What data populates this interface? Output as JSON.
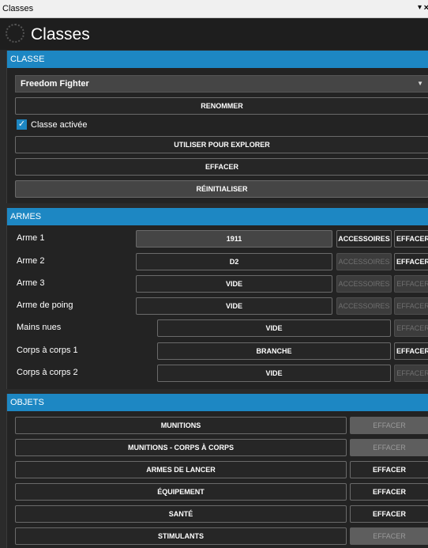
{
  "window": {
    "title": "Classes",
    "menu_icon": "▾",
    "close_icon": "×"
  },
  "header": {
    "title": "Classes",
    "logo_icon": "circle-dotted-icon"
  },
  "classe": {
    "section_label": "CLASSE",
    "selected": "Freedom Fighter",
    "dropdown_icon": "▼",
    "rename_label": "RENOMMER",
    "active_label": "Classe activée",
    "active_checked": true,
    "check_mark": "✓",
    "explore_label": "UTILISER POUR EXPLORER",
    "clear_label": "EFFACER",
    "reset_label": "RÉINITIALISER"
  },
  "armes": {
    "section_label": "ARMES",
    "rows": [
      {
        "label": "Arme 1",
        "value": "1911",
        "accessories": "ACCESSOIRES",
        "accessories_enabled": true,
        "clear": "EFFACER",
        "clear_enabled": true
      },
      {
        "label": "Arme 2",
        "value": "D2",
        "accessories": "ACCESSOIRES",
        "accessories_enabled": false,
        "clear": "EFFACER",
        "clear_enabled": true
      },
      {
        "label": "Arme 3",
        "value": "VIDE",
        "accessories": "ACCESSOIRES",
        "accessories_enabled": false,
        "clear": "EFFACER",
        "clear_enabled": false
      },
      {
        "label": "Arme de poing",
        "value": "VIDE",
        "accessories": "ACCESSOIRES",
        "accessories_enabled": false,
        "clear": "EFFACER",
        "clear_enabled": false
      },
      {
        "label": "Mains nues",
        "value": "VIDE",
        "clear": "EFFACER",
        "clear_enabled": false
      },
      {
        "label": "Corps à corps 1",
        "value": "BRANCHE",
        "clear": "EFFACER",
        "clear_enabled": true
      },
      {
        "label": "Corps à corps 2",
        "value": "VIDE",
        "clear": "EFFACER",
        "clear_enabled": false
      }
    ]
  },
  "objets": {
    "section_label": "OBJETS",
    "rows": [
      {
        "label": "MUNITIONS",
        "clear": "EFFACER",
        "clear_enabled": false
      },
      {
        "label": "MUNITIONS - CORPS À CORPS",
        "clear": "EFFACER",
        "clear_enabled": false
      },
      {
        "label": "ARMES DE LANCER",
        "clear": "EFFACER",
        "clear_enabled": true
      },
      {
        "label": "ÉQUIPEMENT",
        "clear": "EFFACER",
        "clear_enabled": true
      },
      {
        "label": "SANTÉ",
        "clear": "EFFACER",
        "clear_enabled": true
      },
      {
        "label": "STIMULANTS",
        "clear": "EFFACER",
        "clear_enabled": false
      }
    ]
  }
}
